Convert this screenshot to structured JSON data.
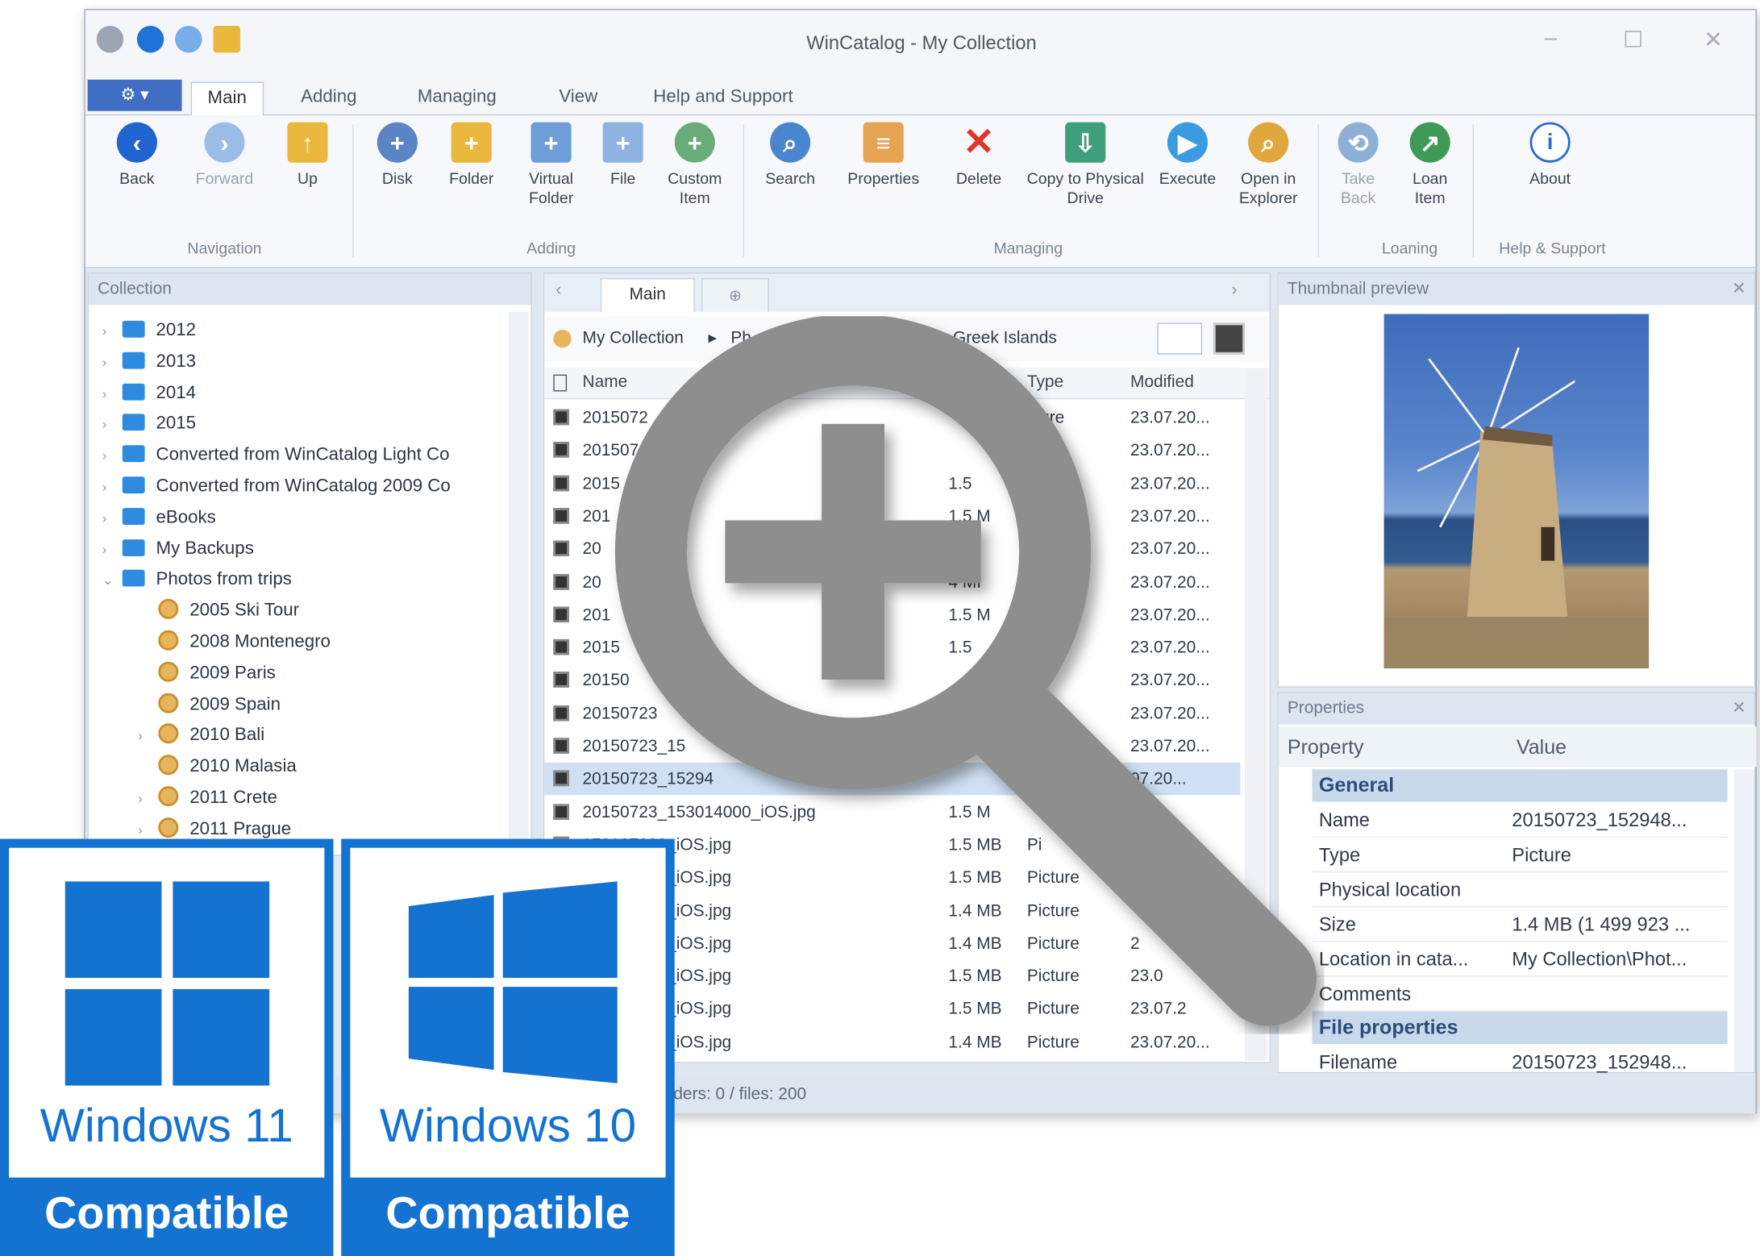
{
  "window": {
    "title": "WinCatalog - My Collection",
    "controls": [
      "–",
      "☐",
      "✕"
    ]
  },
  "ribbon": {
    "file_tab_label": "⚙ ▾",
    "tabs": [
      "Main",
      "Adding",
      "Managing",
      "View",
      "Help and Support"
    ],
    "buttons": {
      "back": "Back",
      "forward": "Forward",
      "up": "Up",
      "disk": "Disk",
      "folder": "Folder",
      "virtual_folder": "Virtual Folder",
      "file": "File",
      "custom_item": "Custom Item",
      "search": "Search",
      "properties": "Properties",
      "delete": "Delete",
      "copy_to_physical": "Copy to Physical Drive",
      "execute": "Execute",
      "open_in_explorer": "Open in Explorer",
      "take_back": "Take Back",
      "loan_item": "Loan Item",
      "about": "About"
    },
    "groups": [
      "Navigation",
      "Adding",
      "Managing",
      "Loaning",
      "Help & Support"
    ]
  },
  "collection": {
    "header": "Collection",
    "items": [
      {
        "label": "2012"
      },
      {
        "label": "2013"
      },
      {
        "label": "2014"
      },
      {
        "label": "2015"
      },
      {
        "label": "Converted from WinCatalog Light Co"
      },
      {
        "label": "Converted from WinCatalog 2009 Co"
      },
      {
        "label": "eBooks"
      },
      {
        "label": "My Backups"
      },
      {
        "label": "Photos from trips"
      },
      {
        "label": "2005 Ski Tour"
      },
      {
        "label": "2008 Montenegro"
      },
      {
        "label": "2009 Paris"
      },
      {
        "label": "2009 Spain"
      },
      {
        "label": "2010 Bali"
      },
      {
        "label": "2010 Malasia"
      },
      {
        "label": "2011 Crete"
      },
      {
        "label": "2011 Prague"
      }
    ]
  },
  "filelist": {
    "tab_main": "Main",
    "breadcrumb": {
      "root": "My Collection",
      "sep": "▸",
      "partial": "Ph",
      "last": "Greek Islands"
    },
    "columns": {
      "name": "Name",
      "type": "Type",
      "modified": "Modified"
    },
    "rows": [
      {
        "name": "2015072",
        "size": "",
        "type": "cture",
        "modified": "23.07.20..."
      },
      {
        "name": "201507",
        "size": "",
        "type": "e",
        "modified": "23.07.20..."
      },
      {
        "name": "2015",
        "size": "1.5",
        "type": "",
        "modified": "23.07.20..."
      },
      {
        "name": "201",
        "size": "1.5 M",
        "type": "",
        "modified": "23.07.20..."
      },
      {
        "name": "20",
        "size": "4 MI",
        "type": "",
        "modified": "23.07.20..."
      },
      {
        "name": "20",
        "size": "4 MI",
        "type": "",
        "modified": "23.07.20..."
      },
      {
        "name": "201",
        "size": "1.5 M",
        "type": "",
        "modified": "23.07.20..."
      },
      {
        "name": "2015",
        "size": "1.5",
        "type": "",
        "modified": "23.07.20..."
      },
      {
        "name": "20150",
        "size": "",
        "type": "re",
        "modified": "23.07.20..."
      },
      {
        "name": "20150723",
        "size": "",
        "type": "",
        "modified": "23.07.20..."
      },
      {
        "name": "20150723_15",
        "size": "",
        "type": "",
        "modified": "23.07.20..."
      },
      {
        "name": "20150723_15294",
        "size": "",
        "type": "",
        "modified": "07.20..."
      },
      {
        "name": "20150723_153014000_iOS.jpg",
        "size": "1.5 M",
        "type": "",
        "modified": ""
      },
      {
        "name": "153107000_iOS.jpg",
        "size": "1.5 MB",
        "type": "Pi",
        "modified": ""
      },
      {
        "name": "153125000_iOS.jpg",
        "size": "1.5 MB",
        "type": "Picture",
        "modified": ""
      },
      {
        "name": "153351000_iOS.jpg",
        "size": "1.4 MB",
        "type": "Picture",
        "modified": ""
      },
      {
        "name": "153406000_iOS.jpg",
        "size": "1.4 MB",
        "type": "Picture",
        "modified": "2"
      },
      {
        "name": "153419000_iOS.jpg",
        "size": "1.5 MB",
        "type": "Picture",
        "modified": "23.0"
      },
      {
        "name": "153429000_iOS.jpg",
        "size": "1.5 MB",
        "type": "Picture",
        "modified": "23.07.2"
      },
      {
        "name": "153438000_iOS.jpg",
        "size": "1.4 MB",
        "type": "Picture",
        "modified": "23.07.20..."
      }
    ]
  },
  "thumbnail": {
    "header": "Thumbnail preview"
  },
  "properties": {
    "header": "Properties",
    "col_property": "Property",
    "col_value": "Value",
    "group_general": "General",
    "rows": [
      {
        "k": "Name",
        "v": "20150723_152948..."
      },
      {
        "k": "Type",
        "v": "Picture"
      },
      {
        "k": "Physical location",
        "v": ""
      },
      {
        "k": "Size",
        "v": "1.4 MB (1 499 923 ..."
      },
      {
        "k": "Location in cata...",
        "v": "My Collection\\Phot..."
      },
      {
        "k": "Comments",
        "v": ""
      }
    ],
    "group_file": "File properties",
    "filename_key": "Filename",
    "filename_val": "20150723_152948..."
  },
  "status": {
    "text": "ders: 0 / files: 200"
  },
  "badges": [
    {
      "os": "Windows 11",
      "label": "Compatible"
    },
    {
      "os": "Windows 10",
      "label": "Compatible"
    }
  ],
  "colors": {
    "accent": "#1473d0",
    "ribbon_blue": "#2f6fd0",
    "magnifier": "#8e8e8e"
  },
  "icons": [
    "back-icon",
    "forward-icon",
    "up-icon",
    "disk-icon",
    "folder-icon",
    "search-icon",
    "delete-icon",
    "about-icon",
    "zoom-in-magnifier-icon",
    "windows-logo-icon"
  ]
}
